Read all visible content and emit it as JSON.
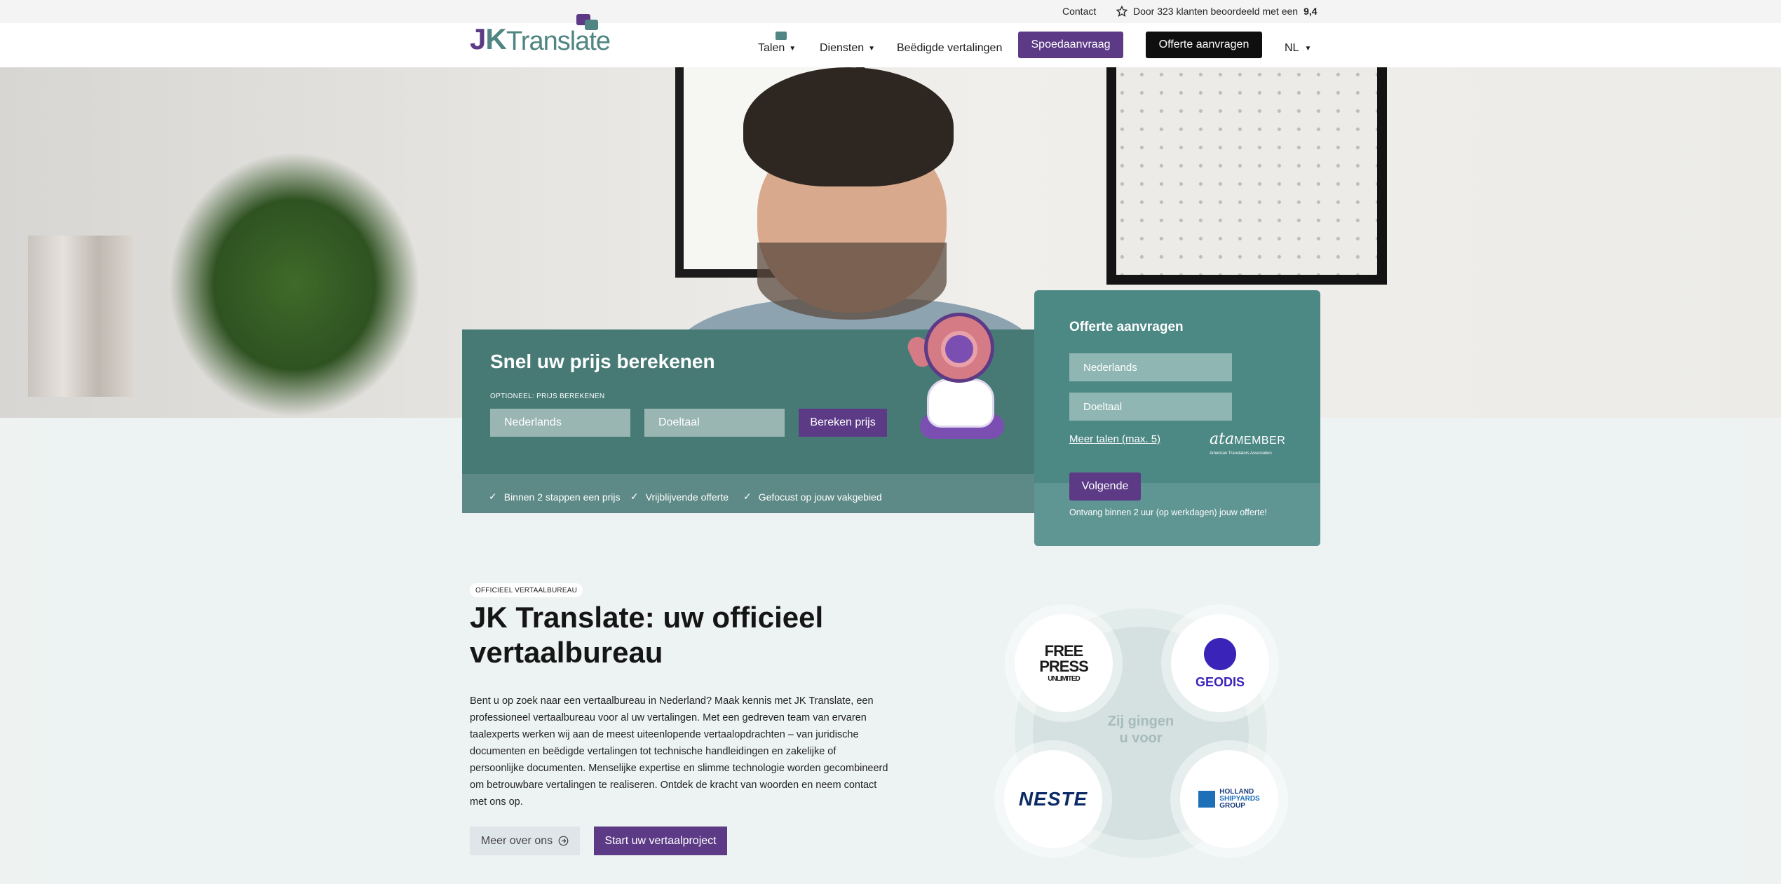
{
  "topbar": {
    "contact": "Contact",
    "rating_prefix": "Door 323 klanten beoordeeld met een",
    "rating_value": "9,4"
  },
  "logo": {
    "jk": "J",
    "k": "K",
    "translate": "Translate"
  },
  "nav": {
    "talen": "Talen",
    "talen_badge": "",
    "diensten": "Diensten",
    "beedigde": "Beëdigde vertalingen",
    "spoed": "Spoedaanvraag",
    "offerte": "Offerte aanvragen",
    "lang": "NL"
  },
  "calculator": {
    "title": "Snel uw prijs berekenen",
    "optional_label": "OPTIONEEL: PRIJS BEREKENEN",
    "source_placeholder": "Nederlands",
    "target_placeholder": "Doeltaal",
    "button": "Bereken prijs",
    "checks": [
      "Binnen 2 stappen een prijs",
      "Vrijblijvende offerte",
      "Gefocust op jouw vakgebied"
    ]
  },
  "offer_form": {
    "title": "Offerte aanvragen",
    "source_placeholder": "Nederlands",
    "target_placeholder": "Doeltaal",
    "more_languages": "Meer talen (max. 5)",
    "ata_logo": "ata",
    "ata_member": "MEMBER",
    "ata_sub": "American Translators Association",
    "next_button": "Volgende",
    "note": "Ontvang binnen 2 uur (op werkdagen) jouw offerte!"
  },
  "about": {
    "badge": "OFFICIEEL VERTAALBUREAU",
    "headline": "JK Translate: uw officieel vertaalbureau",
    "paragraph": "Bent u op zoek naar een vertaalbureau in Nederland? Maak kennis met JK Translate, een professioneel vertaalbureau voor al uw vertalingen. Met een gedreven team van ervaren taalexperts werken wij aan de meest uiteenlopende vertaalopdrachten – van juridische documenten en beëdigde vertalingen tot technische handleidingen en zakelijke of persoonlijke documenten. Menselijke expertise en slimme technologie worden gecombineerd om betrouwbare vertalingen te realiseren. Ontdek de kracht van woorden en neem contact met ons op.",
    "btn_about": "Meer over ons",
    "btn_start": "Start uw vertaalproject"
  },
  "clients": {
    "center_line1": "Zij gingen",
    "center_line2": "u voor",
    "free_press": [
      "FREE",
      "PRESS",
      "UNLIMITED"
    ],
    "geodis": "GEODIS",
    "neste": "NESTE",
    "holland": [
      "HOLLAND",
      "SHIPYARDS",
      "GROUP"
    ]
  },
  "colors": {
    "purple": "#5c3a86",
    "teal": "#477a75",
    "teal_light": "#4c8884",
    "black_button": "#0f0f0f"
  }
}
